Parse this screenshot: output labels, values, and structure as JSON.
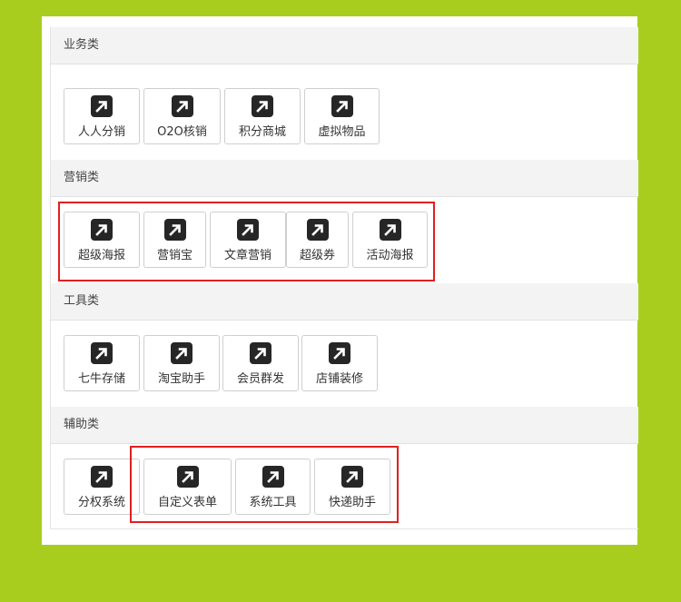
{
  "categories": [
    {
      "title": "业务类",
      "items": [
        "人人分销",
        "O2O核销",
        "积分商城",
        "虚拟物品"
      ]
    },
    {
      "title": "营销类",
      "items": [
        "超级海报",
        "营销宝",
        "文章营销",
        "超级券",
        "活动海报"
      ]
    },
    {
      "title": "工具类",
      "items": [
        "七牛存储",
        "淘宝助手",
        "会员群发",
        "店铺装修"
      ]
    },
    {
      "title": "辅助类",
      "items": [
        "分权系统",
        "自定义表单",
        "系统工具",
        "快递助手"
      ]
    }
  ],
  "colors": {
    "background": "#a9cd1f",
    "highlight": "#e02020",
    "icon": "#262626"
  },
  "icon": "arrow-up-right-icon"
}
